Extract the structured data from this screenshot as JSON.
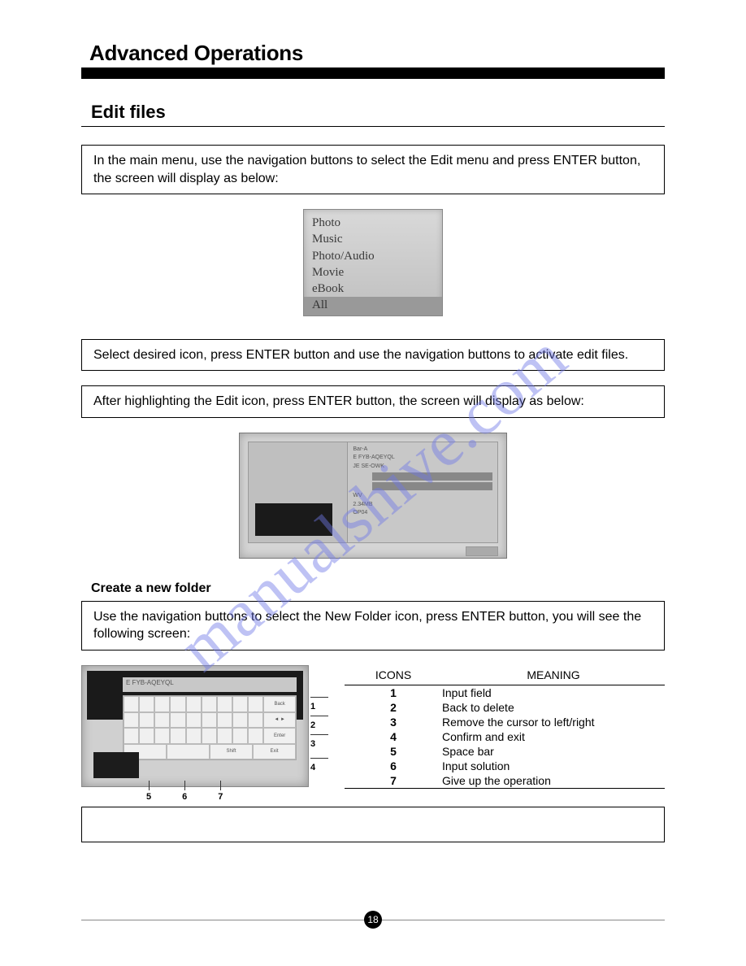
{
  "pageTitle": "Advanced Operations",
  "sectionTitle": "Edit files",
  "paragraphs": {
    "intro": "In the main menu, use the navigation buttons to select the Edit menu and press ENTER button, the screen will display as below:",
    "select": "Select desired icon, press ENTER button and use the navigation buttons to activate edit files.",
    "afterHighlight": "After highlighting the Edit icon, press ENTER button, the screen will display as below:",
    "newFolder": "Use the navigation buttons to select the New Folder icon, press ENTER button, you will see the following screen:"
  },
  "menuItems": [
    "Photo",
    "Music",
    "Photo/Audio",
    "Movie",
    "eBook",
    "All"
  ],
  "subsection": "Create a new folder",
  "iconsTable": {
    "headers": [
      "ICONS",
      "MEANING"
    ],
    "rows": [
      [
        "1",
        "Input field"
      ],
      [
        "2",
        "Back to delete"
      ],
      [
        "3",
        "Remove the cursor to left/right"
      ],
      [
        "4",
        "Confirm and exit"
      ],
      [
        "5",
        "Space bar"
      ],
      [
        "6",
        "Input solution"
      ],
      [
        "7",
        "Give up the operation"
      ]
    ]
  },
  "callouts": {
    "right": [
      "1",
      "2",
      "3",
      "4"
    ],
    "bottom": [
      "5",
      "6",
      "7"
    ]
  },
  "watermark": "manualshive.com",
  "pageNumber": "18"
}
